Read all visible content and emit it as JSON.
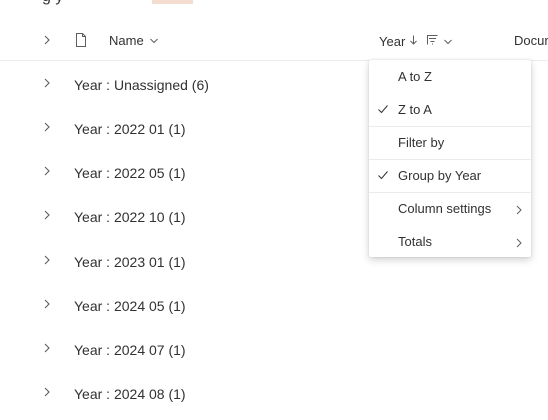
{
  "page": {
    "title_partial": "g   y"
  },
  "header": {
    "name_label": "Name",
    "year_label": "Year",
    "doc_label": "Docur"
  },
  "rows": [
    {
      "label": "Year : Unassigned (6)"
    },
    {
      "label": "Year : 2022 01 (1)"
    },
    {
      "label": "Year : 2022 05 (1)"
    },
    {
      "label": "Year : 2022 10 (1)"
    },
    {
      "label": "Year : 2023 01 (1)"
    },
    {
      "label": "Year : 2024 05 (1)"
    },
    {
      "label": "Year : 2024 07 (1)"
    },
    {
      "label": "Year : 2024 08 (1)"
    }
  ],
  "menu": {
    "items": [
      {
        "label": "A to Z",
        "checked": false
      },
      {
        "label": "Z to A",
        "checked": true
      },
      {
        "label": "Filter by",
        "checked": false
      },
      {
        "label": "Group by Year",
        "checked": true
      },
      {
        "label": "Column settings",
        "submenu": true
      },
      {
        "label": "Totals",
        "submenu": true
      }
    ]
  },
  "colors": {
    "text": "#323130",
    "icon": "#605e5c",
    "divider": "#edebe9",
    "title_highlight": "#f4dcd1"
  },
  "icons": {
    "expand": "chevron-right-icon",
    "document": "document-icon",
    "sort": "sort-down-arrow-icon",
    "filter": "filter-icon",
    "dropdown": "chevron-down-icon",
    "check": "checkmark-icon"
  }
}
